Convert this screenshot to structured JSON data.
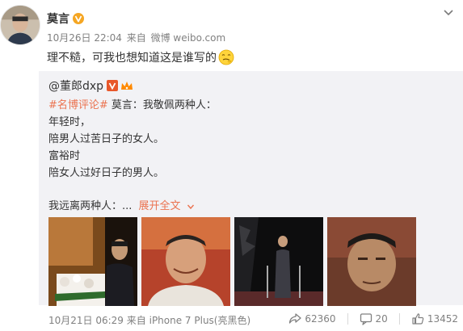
{
  "post": {
    "author": "莫言",
    "timestamp": "10月26日 22:04",
    "source_prefix": "来自",
    "source": "微博 weibo.com",
    "text": "理不糙，可我也想知道这是谁写的",
    "emoji": "thinking-face"
  },
  "repost": {
    "author": "@董郎dxp",
    "topic": "#名博评论#",
    "line1_rest": " 莫言：我敬佩两种人：",
    "line2": "年轻时，",
    "line3": "陪男人过苦日子的女人。",
    "line4": "富裕时",
    "line5": "陪女人过好日子的男人。",
    "line6": "我远离两种人：...",
    "expand_label": "展开全文",
    "photos": [
      "portrait-podium",
      "portrait-smiling",
      "stage-ceremony",
      "portrait-closeup"
    ],
    "timestamp": "10月21日 06:29",
    "source_prefix": "来自",
    "source": "iPhone 7 Plus(亮黑色)",
    "repost_count": "62360",
    "comment_count": "20",
    "like_count": "13452"
  },
  "colors": {
    "accent_orange": "#eb7350",
    "verified_gold": "#f5a623",
    "repost_bg": "#f2f2f5",
    "meta_gray": "#808080"
  }
}
